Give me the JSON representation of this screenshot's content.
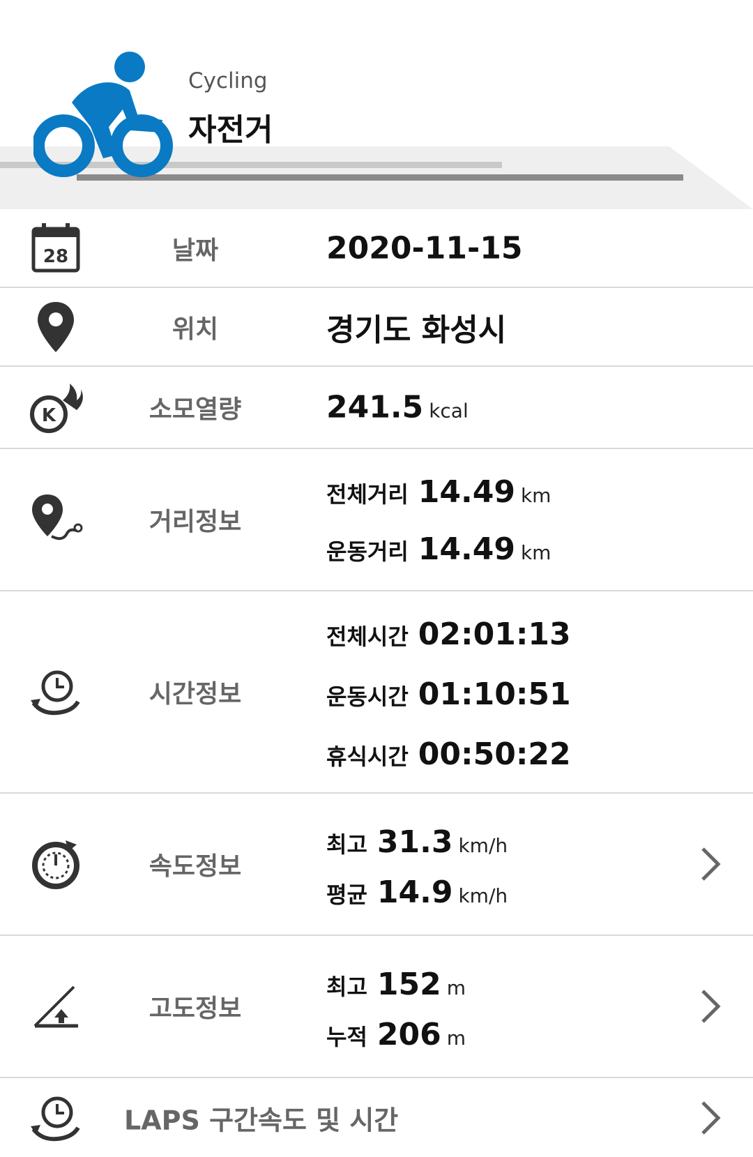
{
  "header": {
    "subtitle": "Cycling",
    "title": "자전거",
    "accent_color": "#0a7ac4",
    "icon": "cyclist-icon"
  },
  "rows": {
    "date": {
      "icon": "calendar-icon",
      "icon_text": "28",
      "label": "날짜",
      "value": "2020-11-15"
    },
    "location": {
      "icon": "map-pin-icon",
      "label": "위치",
      "value": "경기도 화성시"
    },
    "calories": {
      "icon": "calorie-flame-icon",
      "icon_text": "K",
      "label": "소모열량",
      "value": "241.5",
      "unit": "kcal"
    },
    "distance": {
      "icon": "route-pin-icon",
      "label": "거리정보",
      "total_label": "전체거리",
      "total_value": "14.49",
      "total_unit": "km",
      "exercise_label": "운동거리",
      "exercise_value": "14.49",
      "exercise_unit": "km"
    },
    "time": {
      "icon": "stopwatch-icon",
      "label": "시간정보",
      "total_label": "전체시간",
      "total_value": "02:01:13",
      "exercise_label": "운동시간",
      "exercise_value": "01:10:51",
      "rest_label": "휴식시간",
      "rest_value": "00:50:22"
    },
    "speed": {
      "icon": "speedometer-icon",
      "label": "속도정보",
      "max_label": "최고",
      "max_value": "31.3",
      "max_unit": "km/h",
      "avg_label": "평균",
      "avg_value": "14.9",
      "avg_unit": "km/h"
    },
    "altitude": {
      "icon": "elevation-icon",
      "label": "고도정보",
      "max_label": "최고",
      "max_value": "152",
      "max_unit": "m",
      "cum_label": "누적",
      "cum_value": "206",
      "cum_unit": "m"
    },
    "laps": {
      "icon": "lap-timer-icon",
      "label": "LAPS 구간속도 및 시간"
    }
  }
}
